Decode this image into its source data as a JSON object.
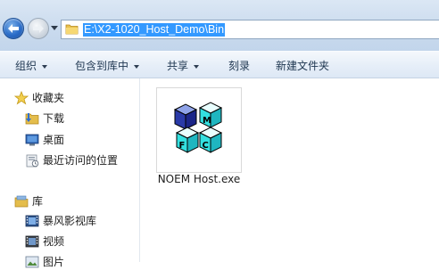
{
  "address_bar": {
    "path": "E:\\X2-1020_Host_Demo\\Bin"
  },
  "toolbar": {
    "organize": "组织",
    "include_in_library": "包含到库中",
    "share": "共享",
    "burn": "刻录",
    "new_folder": "新建文件夹"
  },
  "sidebar": {
    "favorites": {
      "label": "收藏夹",
      "items": [
        {
          "label": "下载",
          "icon": "download-folder-icon"
        },
        {
          "label": "桌面",
          "icon": "desktop-icon"
        },
        {
          "label": "最近访问的位置",
          "icon": "recent-places-icon"
        }
      ]
    },
    "libraries": {
      "label": "库",
      "items": [
        {
          "label": "暴风影视库",
          "icon": "video-library-icon"
        },
        {
          "label": "视频",
          "icon": "video-icon"
        },
        {
          "label": "图片",
          "icon": "pictures-icon"
        }
      ]
    }
  },
  "content": {
    "files": [
      {
        "name": "NOEM Host.exe",
        "icon": "mfc-app-icon"
      }
    ]
  },
  "colors": {
    "selection": "#3399ff",
    "toolbar_text": "#1e3650"
  }
}
